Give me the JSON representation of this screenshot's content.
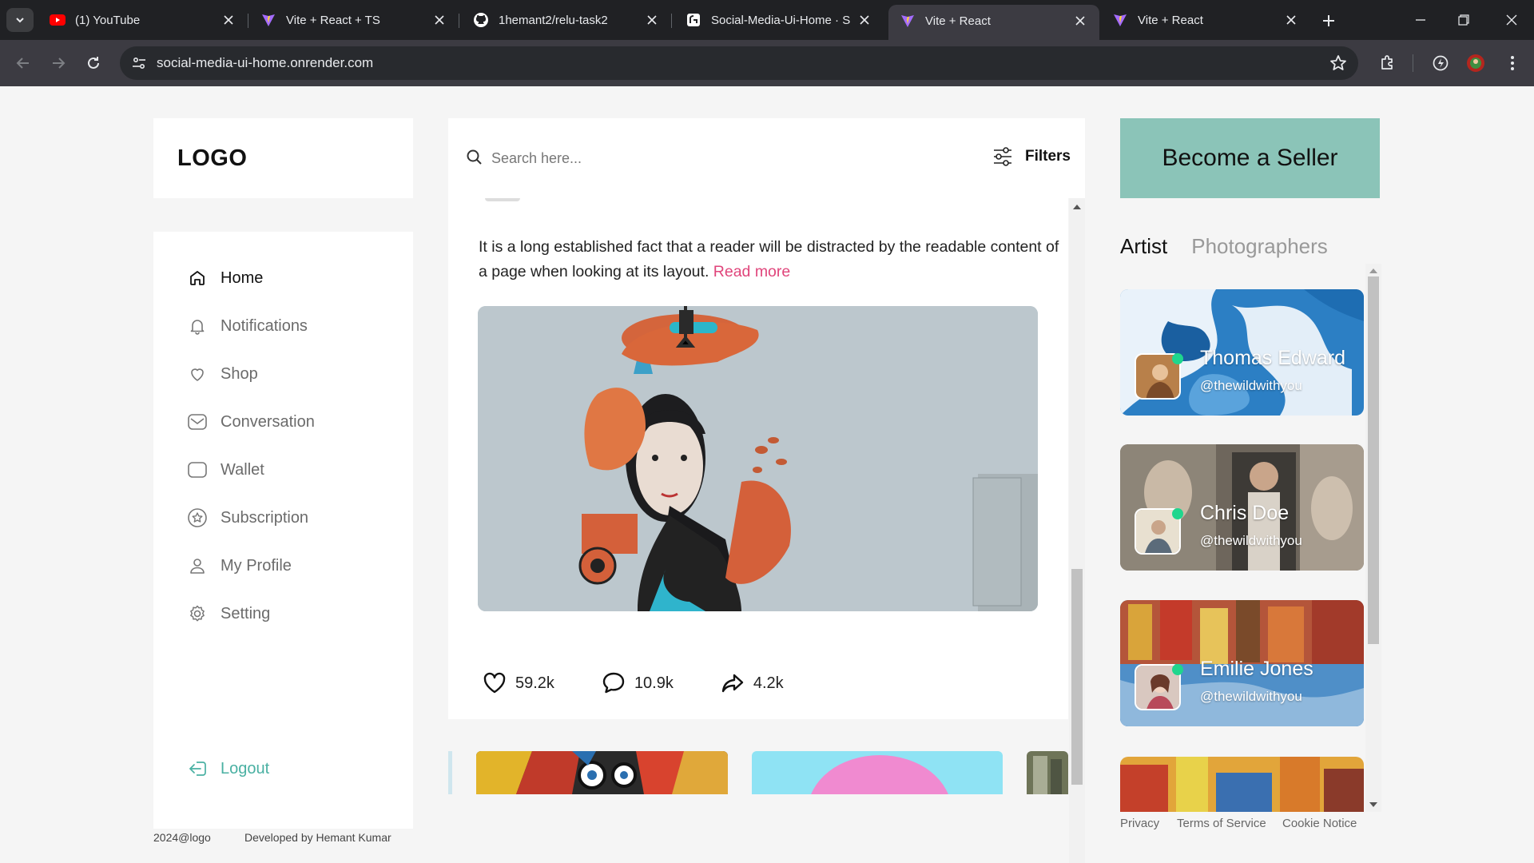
{
  "browser": {
    "tabs": [
      {
        "title": "(1) YouTube",
        "favicon": "youtube-icon"
      },
      {
        "title": "Vite + React + TS",
        "favicon": "vite-icon"
      },
      {
        "title": "1hemant2/relu-task2",
        "favicon": "github-icon"
      },
      {
        "title": "Social-Media-Ui-Home · S",
        "favicon": "render-icon"
      },
      {
        "title": "Vite + React",
        "favicon": "vite-icon",
        "active": true
      },
      {
        "title": "Vite + React",
        "favicon": "vite-icon"
      }
    ],
    "url": "social-media-ui-home.onrender.com"
  },
  "sidebar": {
    "logo": "LOGO",
    "items": [
      {
        "label": "Home",
        "icon": "home-icon",
        "active": true
      },
      {
        "label": "Notifications",
        "icon": "bell-icon"
      },
      {
        "label": "Shop",
        "icon": "heart-icon"
      },
      {
        "label": "Conversation",
        "icon": "mail-icon"
      },
      {
        "label": "Wallet",
        "icon": "wallet-icon"
      },
      {
        "label": "Subscription",
        "icon": "badge-icon"
      },
      {
        "label": "My Profile",
        "icon": "user-icon"
      },
      {
        "label": "Setting",
        "icon": "gear-icon"
      }
    ],
    "logout": "Logout"
  },
  "footer": {
    "copyright": "2024@logo",
    "developer": "Developed by Hemant Kumar"
  },
  "search": {
    "placeholder": "Search here...",
    "filters_label": "Filters"
  },
  "post": {
    "text": "It is a long established fact that a reader will be distracted by the readable content of a page when looking at its layout.",
    "read_more": "Read more",
    "likes": "59.2k",
    "comments": "10.9k",
    "shares": "4.2k"
  },
  "right": {
    "seller_button": "Become a Seller",
    "tabs": [
      {
        "label": "Artist",
        "active": true
      },
      {
        "label": "Photographers",
        "active": false
      }
    ],
    "artists": [
      {
        "name": "Thomas Edward",
        "handle": "@thewildwithyou"
      },
      {
        "name": "Chris Doe",
        "handle": "@thewildwithyou"
      },
      {
        "name": "Emilie Jones",
        "handle": "@thewildwithyou"
      }
    ],
    "footer_links": [
      "Privacy",
      "Terms of Service",
      "Cookie Notice"
    ]
  },
  "colors": {
    "accent_teal": "#8bc4b8",
    "logout_teal": "#49b0a2",
    "read_more_pink": "#e0457b",
    "online_green": "#1fd68d"
  }
}
